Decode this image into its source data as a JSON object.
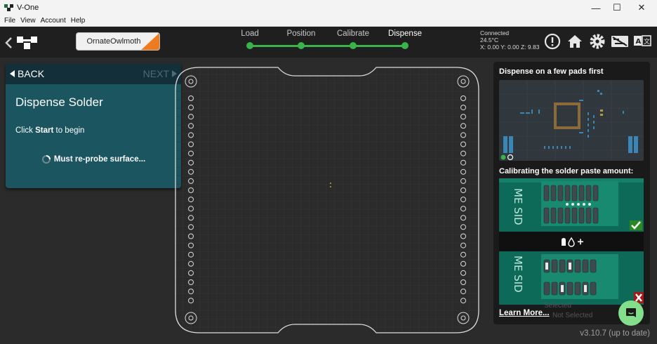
{
  "window": {
    "title": "V-One",
    "minimize": "—",
    "maximize": "☐",
    "close": "✕"
  },
  "menu": [
    "File",
    "View",
    "Account",
    "Help"
  ],
  "topbar": {
    "device_name": "OrnateOwlmoth",
    "steps": [
      {
        "label": "Load",
        "active": false
      },
      {
        "label": "Position",
        "active": false
      },
      {
        "label": "Calibrate",
        "active": false
      },
      {
        "label": "Dispense",
        "active": true
      }
    ],
    "status": {
      "connection": "Connected",
      "temperature": "24.5°C",
      "coords": "X: 0.00 Y: 0.00 Z: 9.83"
    },
    "icons": [
      "alert-icon",
      "home-icon",
      "settings-icon",
      "keyboard-icon",
      "language-icon"
    ],
    "accent_color": "#36b649",
    "brand_orange": "#f07a1e"
  },
  "left_panel": {
    "back_label": "BACK",
    "next_label": "NEXT",
    "title": "Dispense Solder",
    "instruction_prefix": "Click ",
    "instruction_bold": "Start",
    "instruction_suffix": " to begin",
    "reprobe_text": "Must re-probe surface..."
  },
  "right_panel": {
    "heading_1": "Dispense on a few pads first",
    "heading_2": "Calibrating the solder paste amount:",
    "learn_more": "Learn More...",
    "legend_selected": "Selected",
    "legend_not_selected": "Not Selected"
  },
  "footer": {
    "version": "v3.10.7 (up to date)"
  }
}
